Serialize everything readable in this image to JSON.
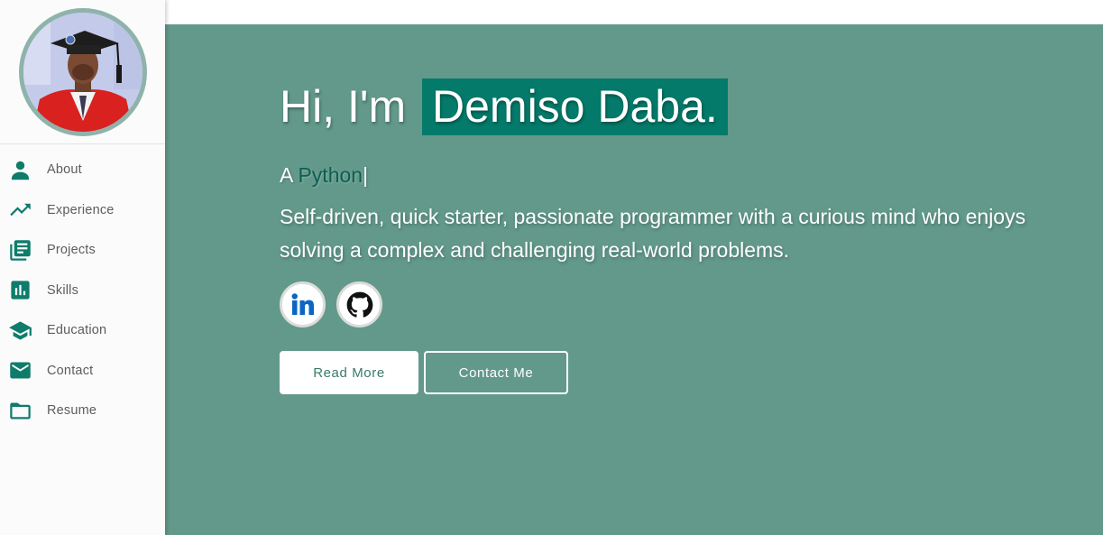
{
  "sidebar": {
    "items": [
      {
        "label": "About",
        "icon": "person-icon"
      },
      {
        "label": "Experience",
        "icon": "trending-up-icon"
      },
      {
        "label": "Projects",
        "icon": "library-books-icon"
      },
      {
        "label": "Skills",
        "icon": "bar-chart-icon"
      },
      {
        "label": "Education",
        "icon": "graduation-cap-icon"
      },
      {
        "label": "Contact",
        "icon": "mail-icon"
      },
      {
        "label": "Resume",
        "icon": "folder-icon"
      }
    ]
  },
  "hero": {
    "greeting": "Hi, I'm",
    "name": "Demiso Daba.",
    "typed_prefix": "A",
    "typed_word": "Python",
    "typed_cursor": "|",
    "bio": "Self-driven, quick starter, passionate programmer with a curious mind who enjoys solving a complex and challenging real-world problems.",
    "socials": [
      {
        "name": "linkedin-icon"
      },
      {
        "name": "github-icon"
      }
    ],
    "read_more_label": "Read More",
    "contact_label": "Contact Me"
  },
  "colors": {
    "accent": "#0f7c6b",
    "hero_background": "#62998a",
    "name_highlight": "#047a6a"
  }
}
